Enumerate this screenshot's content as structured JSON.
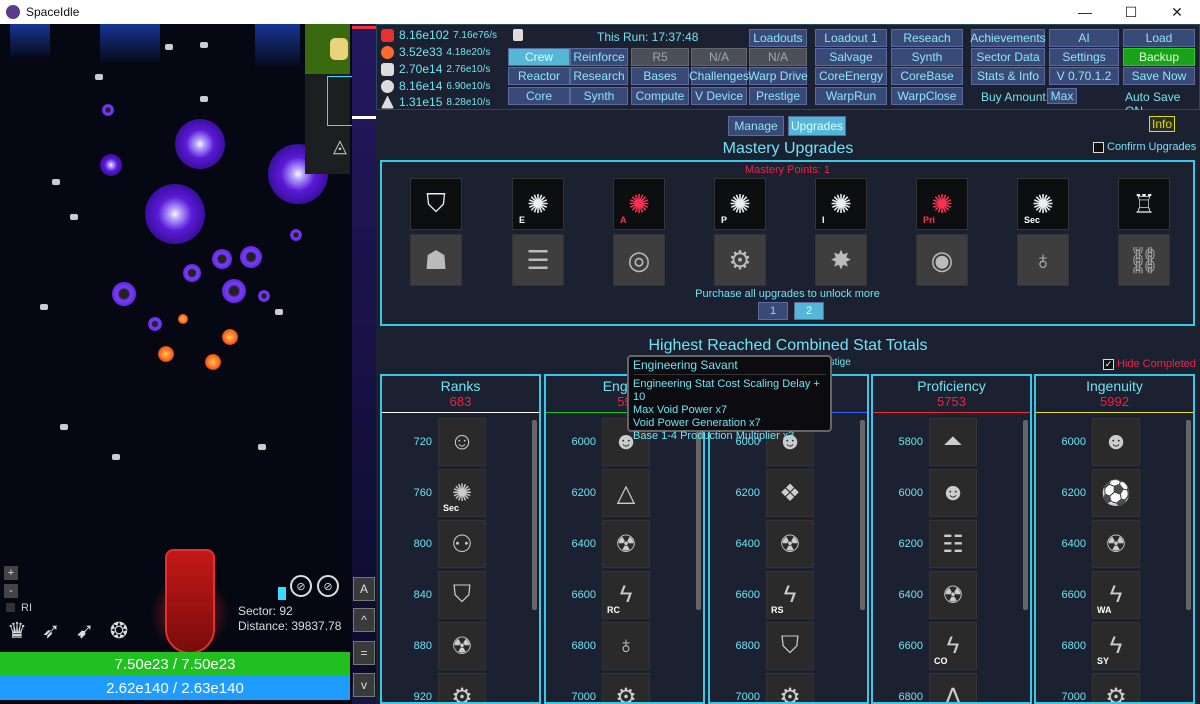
{
  "window": {
    "title": "SpaceIdle",
    "controls": [
      "—",
      "☐",
      "✕"
    ]
  },
  "game": {
    "rl_label": "RI",
    "sector_label": "Sector: 92",
    "distance_label": "Distance: 39837.78",
    "hp_text": "7.50e23 / 7.50e23",
    "shield_text": "2.62e140 / 2.63e140",
    "zoom_plus": "+",
    "zoom_minus": "-",
    "side_buttons": [
      "A",
      "^",
      "=",
      "v"
    ],
    "hp_fraction": 1.0,
    "shield_fraction": 0.996
  },
  "resources": [
    {
      "icon": "no-entry-icon",
      "color": "#e83030",
      "amount": "8.16e102",
      "rate": "7.16e76/s"
    },
    {
      "icon": "orange-orb-icon",
      "color": "#ff6a2a",
      "amount": "3.52e33",
      "rate": "4.18e20/s"
    },
    {
      "icon": "stack-icon",
      "color": "#dddddd",
      "amount": "2.70e14",
      "rate": "2.76e10/s"
    },
    {
      "icon": "ball-icon",
      "color": "#dddddd",
      "amount": "8.16e14",
      "rate": "6.90e10/s"
    },
    {
      "icon": "triangle-icon",
      "color": "#dddddd",
      "amount": "1.31e15",
      "rate": "8.28e10/s"
    }
  ],
  "this_run": "This Run: 17:37:48",
  "nav": {
    "crew": "Crew",
    "reinforce": "Reinforce",
    "r5": "R5",
    "na1": "N/A",
    "na2": "N/A",
    "loadouts": "Loadouts",
    "reactor": "Reactor",
    "research": "Research",
    "bases": "Bases",
    "challenges": "Challenges",
    "warp_drive": "Warp Drive",
    "core": "Core",
    "synth": "Synth",
    "compute": "Compute",
    "v_device": "V Device",
    "prestige": "Prestige",
    "loadout1": "Loadout 1",
    "reseach": "Reseach",
    "salvage": "Salvage",
    "synth2": "Synth",
    "core_energy": "CoreEnergy",
    "core_base": "CoreBase",
    "warp_run": "WarpRun",
    "warp_close": "WarpClose",
    "achievements": "Achievements",
    "ai": "AI",
    "load": "Load",
    "sector_data": "Sector Data",
    "settings": "Settings",
    "backup": "Backup",
    "stats_info": "Stats & Info",
    "version": "V 0.70.1.2",
    "save_now": "Save Now",
    "buy_amount": "Buy Amount:",
    "max": "Max",
    "auto_save": "Auto Save ON"
  },
  "main": {
    "manage": "Manage",
    "upgrades": "Upgrades",
    "info": "Info",
    "mastery_title": "Mastery Upgrades",
    "confirm": "Confirm Upgrades",
    "mastery_points": "Mastery Points: 1",
    "purchase": "Purchase all upgrades to unlock more",
    "pages": [
      "1",
      "2"
    ],
    "stat_title": "Highest Reached Combined Stat Totals",
    "subtext": "ched and persist on prestige",
    "hide_completed": "Hide Completed"
  },
  "mastery_row1": [
    {
      "icon": "rank-badge-icon",
      "sub": ""
    },
    {
      "icon": "engineering-brain-icon",
      "sub": "E"
    },
    {
      "icon": "attack-brain-icon",
      "sub": "A"
    },
    {
      "icon": "power-brain-icon",
      "sub": "P"
    },
    {
      "icon": "intel-brain-icon",
      "sub": "I"
    },
    {
      "icon": "primary-brain-icon",
      "sub": "Pri"
    },
    {
      "icon": "secondary-brain-icon",
      "sub": "Sec"
    },
    {
      "icon": "crew-chair-icon",
      "sub": ""
    }
  ],
  "mastery_row2": [
    {
      "icon": "crew-group-icon"
    },
    {
      "icon": "server-rack-icon"
    },
    {
      "icon": "vortex-icon"
    },
    {
      "icon": "gears-icon"
    },
    {
      "icon": "shatter-icon"
    },
    {
      "icon": "spiral-icon"
    },
    {
      "icon": "satellite-icon"
    },
    {
      "icon": "chain-link-icon"
    }
  ],
  "columns": [
    {
      "name": "Ranks",
      "value": "683",
      "color": "#ffffff",
      "rows": [
        {
          "n": "720",
          "icon": "juggler-icon",
          "sub": ""
        },
        {
          "n": "760",
          "icon": "brain-icon",
          "sub": "Sec"
        },
        {
          "n": "800",
          "icon": "org-chart-icon",
          "sub": ""
        },
        {
          "n": "840",
          "icon": "rank-badge-icon",
          "sub": ""
        },
        {
          "n": "880",
          "icon": "bio-icon",
          "sub": ""
        },
        {
          "n": "920",
          "icon": "gear-icon",
          "sub": ""
        }
      ]
    },
    {
      "name": "Engine",
      "value": "59",
      "color": "#1fc01f",
      "rows": [
        {
          "n": "6000",
          "icon": "person-icon",
          "sub": ""
        },
        {
          "n": "6200",
          "icon": "penrose-icon",
          "sub": ""
        },
        {
          "n": "6400",
          "icon": "bio-icon",
          "sub": ""
        },
        {
          "n": "6600",
          "icon": "bolt-icon",
          "sub": "RC"
        },
        {
          "n": "6800",
          "icon": "satellite-icon",
          "sub": ""
        },
        {
          "n": "7000",
          "icon": "gear-icon",
          "sub": ""
        }
      ]
    },
    {
      "name": "",
      "value": "",
      "color": "#3060ff",
      "rows": [
        {
          "n": "6000",
          "icon": "person-icon",
          "sub": ""
        },
        {
          "n": "6200",
          "icon": "chevron-badge-icon",
          "sub": ""
        },
        {
          "n": "6400",
          "icon": "bio-icon",
          "sub": ""
        },
        {
          "n": "6600",
          "icon": "bolt-icon",
          "sub": "RS"
        },
        {
          "n": "6800",
          "icon": "rank-badge-icon",
          "sub": ""
        },
        {
          "n": "7000",
          "icon": "gear-icon",
          "sub": ""
        }
      ]
    },
    {
      "name": "Proficiency",
      "value": "5753",
      "color": "#e83030",
      "rows": [
        {
          "n": "5800",
          "icon": "pyramid-icon",
          "sub": ""
        },
        {
          "n": "6000",
          "icon": "person-icon",
          "sub": ""
        },
        {
          "n": "6200",
          "icon": "database-icon",
          "sub": ""
        },
        {
          "n": "6400",
          "icon": "bio-icon",
          "sub": ""
        },
        {
          "n": "6600",
          "icon": "bolt-icon",
          "sub": "CO"
        },
        {
          "n": "6800",
          "icon": "spikes-icon",
          "sub": ""
        }
      ]
    },
    {
      "name": "Ingenuity",
      "value": "5992",
      "color": "#e8e030",
      "rows": [
        {
          "n": "6000",
          "icon": "person-icon",
          "sub": ""
        },
        {
          "n": "6200",
          "icon": "soccer-icon",
          "sub": ""
        },
        {
          "n": "6400",
          "icon": "bio-icon",
          "sub": ""
        },
        {
          "n": "6600",
          "icon": "bolt-icon",
          "sub": "WA"
        },
        {
          "n": "6800",
          "icon": "bolt-icon",
          "sub": "SY"
        },
        {
          "n": "7000",
          "icon": "gear-icon",
          "sub": ""
        }
      ]
    }
  ],
  "tooltip": {
    "title": "Engineering Savant",
    "lines": [
      "Engineering Stat Cost Scaling Delay + 10",
      "Max Void Power x7",
      "Void Power Generation x7",
      "Base 1-4 Production Multiplier x3"
    ]
  }
}
